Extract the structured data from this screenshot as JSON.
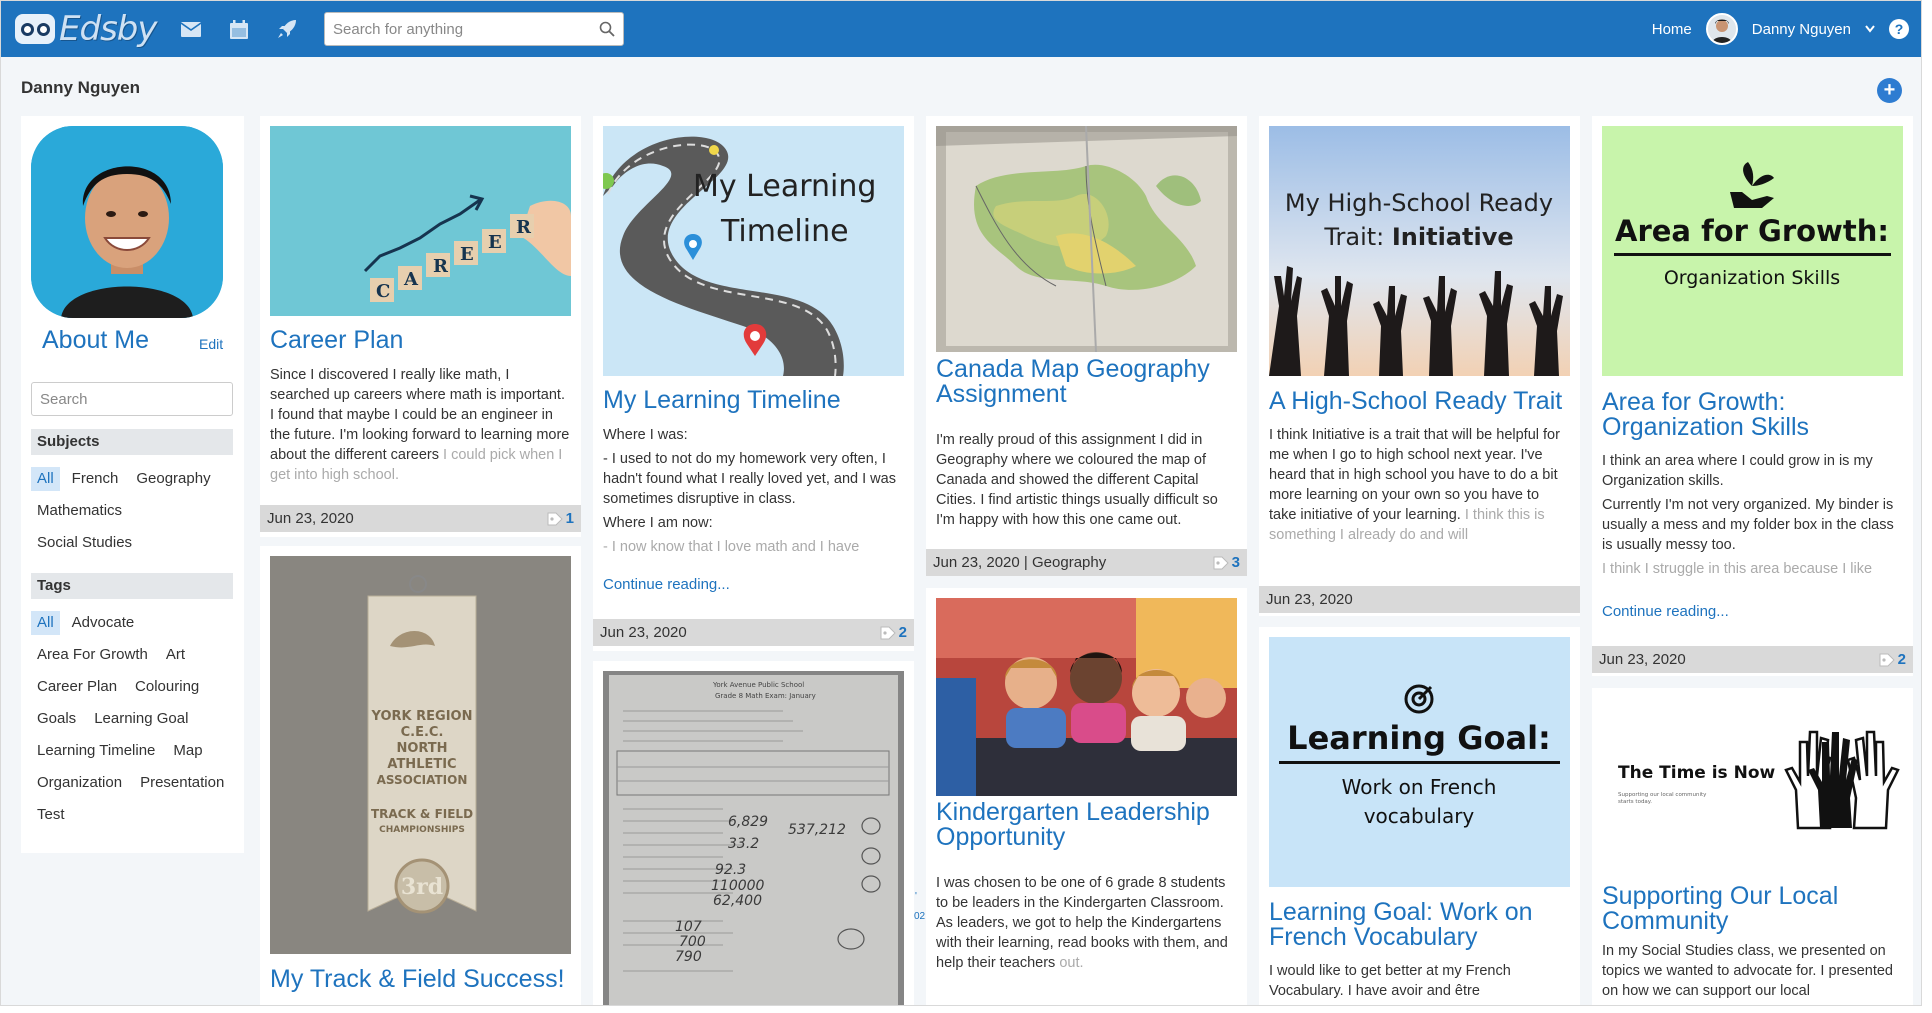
{
  "app": {
    "logo_text": "Edsby",
    "brand_color": "#1e73be"
  },
  "topbar": {
    "icons": [
      "mail-icon",
      "calendar-icon",
      "rocket-icon",
      "bell-icon"
    ],
    "search_placeholder": "Search for anything",
    "home_label": "Home",
    "user_name": "Danny Nguyen",
    "help_label": "?"
  },
  "page": {
    "title": "Danny Nguyen",
    "add_label": "+"
  },
  "sidebar": {
    "about_me": "About Me",
    "edit": "Edit",
    "search_placeholder": "Search",
    "subjects_heading": "Subjects",
    "subjects": [
      "All",
      "French",
      "Geography",
      "Mathematics",
      "Social Studies"
    ],
    "tags_heading": "Tags",
    "tags": [
      "All",
      "Advocate",
      "Area For Growth",
      "Art",
      "Career Plan",
      "Colouring",
      "Goals",
      "Learning Goal",
      "Learning Timeline",
      "Map",
      "Organization",
      "Presentation",
      "Test"
    ]
  },
  "cards": {
    "career": {
      "image_letters": [
        "C",
        "A",
        "R",
        "E",
        "E",
        "R"
      ],
      "title": "Career Plan",
      "body": "Since I discovered I really like math, I searched up careers where math is important. I found that maybe I could be an engineer in the future. I'm looking forward to learning more about the different careers",
      "body_fade": "I could pick when I get into high school.",
      "date": "Jun 23, 2020",
      "tags": "1"
    },
    "track": {
      "ribbon_lines": [
        "YORK REGION",
        "C.E.C.",
        "NORTH",
        "ATHLETIC",
        "ASSOCIATION",
        "TRACK & FIELD",
        "CHAMPIONSHIPS",
        "3rd"
      ],
      "title": "My Track & Field Success!"
    },
    "timeline": {
      "image_text_1": "My Learning",
      "image_text_2": "Timeline",
      "title": "My Learning Timeline",
      "p1": "Where I was:",
      "p2": "- I used to not do my homework very often, I hadn't found what I really loved yet, and I was sometimes disruptive in class.",
      "p3": "Where I am now:",
      "p4_fade": "- I now know that I love math and I have",
      "more": "Continue reading...",
      "date": "Jun 23, 2020",
      "tags": "2"
    },
    "mathtest": {
      "sheet_title": "York Avenue Public School",
      "sheet_subtitle": "Grade 8 Math Exam: January",
      "answers": [
        "6,829",
        "537,212",
        "33.2",
        "92.3",
        "110000",
        "62,400",
        "107",
        "700",
        "790"
      ]
    },
    "canada": {
      "title": "Canada Map Geography Assignment",
      "body": "I'm really proud of this assignment I did in Geography where we coloured the map of Canada and showed the different Capital Cities. I find artistic things usually difficult so I'm happy with how this one came out.",
      "date": "Jun 23, 2020",
      "subject": "Geography",
      "tags": "3"
    },
    "kinder": {
      "title": "Kindergarten Leadership Opportunity",
      "body": "I was chosen to be one of 6 grade 8 students to be leaders in the Kindergarten Classroom. As leaders, we got to help the Kindergartens with their learning, read books with them, and help their teachers",
      "body_fade": "out."
    },
    "trait": {
      "image_text_1": "My High-School Ready",
      "image_text_2a": "Trait: ",
      "image_text_2b": "Initiative",
      "title": "A High-School Ready Trait",
      "body": "I think Initiative is a trait that will be helpful for me when I go to high school next year. I've heard that in high school you have to do a bit more learning on your own so you have to take initiative of your learning.",
      "body_fade": "I think this is something I already do and will",
      "date": "Jun 23, 2020"
    },
    "french": {
      "image_title": "Learning Goal:",
      "image_sub_1": "Work on French",
      "image_sub_2": "vocabulary",
      "title": "Learning Goal: Work on French Vocabulary",
      "body": "I would like to get better at my French Vocabulary. I have avoir and être"
    },
    "growth": {
      "image_title": "Area for Growth:",
      "image_sub": "Organization Skills",
      "title": "Area for Growth: Organization Skills",
      "p1": "I think an area where I could grow in is my Organization skills.",
      "p2": "Currently I'm not very organized. My binder is usually a mess and my folder box in the class is usually messy too.",
      "p3_fade": "I think I struggle in this area because I like",
      "more": "Continue reading...",
      "date": "Jun 23, 2020",
      "tags": "2"
    },
    "community": {
      "image_title": "The Time is Now",
      "image_sub_1": "Supporting our local community",
      "image_sub_2": "starts today.",
      "title": "Supporting Our Local Community",
      "body": "In my Social Studies class, we presented on topics we wanted to advocate for. I presented on how we can support our local"
    }
  },
  "stray_text": [
    "'",
    "02"
  ]
}
